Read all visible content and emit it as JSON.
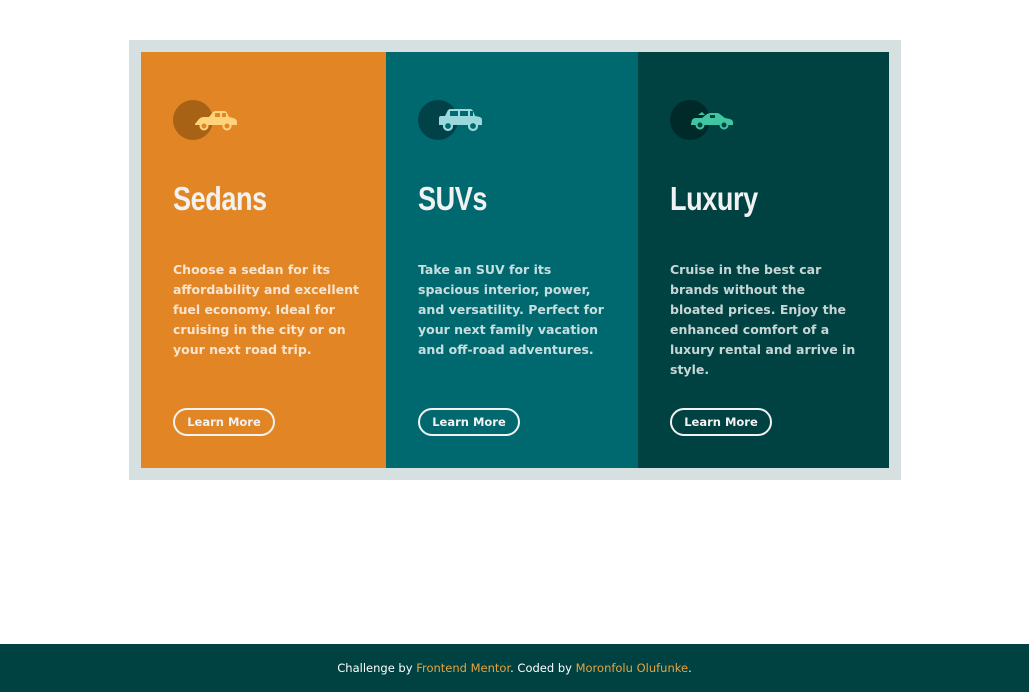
{
  "cards": [
    {
      "id": "sedans",
      "icon": "sedan-car-icon",
      "accent": "#e28625",
      "icon_color": "#ffd37a",
      "title": "Sedans",
      "description": "Choose a sedan for its affordability and excellent fuel economy. Ideal for cruising in the city or on your next road trip.",
      "button_label": "Learn More"
    },
    {
      "id": "suvs",
      "icon": "suv-car-icon",
      "accent": "#006970",
      "icon_color": "#9bd8dc",
      "title": "SUVs",
      "description": "Take an SUV for its spacious interior, power, and versatility. Perfect for your next family vacation and off-road adventures.",
      "button_label": "Learn More"
    },
    {
      "id": "luxury",
      "icon": "luxury-car-icon",
      "accent": "#004141",
      "icon_color": "#40c7a2",
      "title": "Luxury",
      "description": "Cruise in the best car brands without the bloated prices. Enjoy the enhanced comfort of a luxury rental and arrive in style.",
      "button_label": "Learn More"
    }
  ],
  "footer": {
    "prefix": "Challenge by ",
    "challenge_link": "Frontend Mentor",
    "middle": ". Coded by ",
    "author_link": "Moronfolu Olufunke",
    "suffix": "."
  },
  "colors": {
    "frame": "#d7e0e0",
    "footer_bg": "#004141",
    "link": "#e8a33d"
  }
}
